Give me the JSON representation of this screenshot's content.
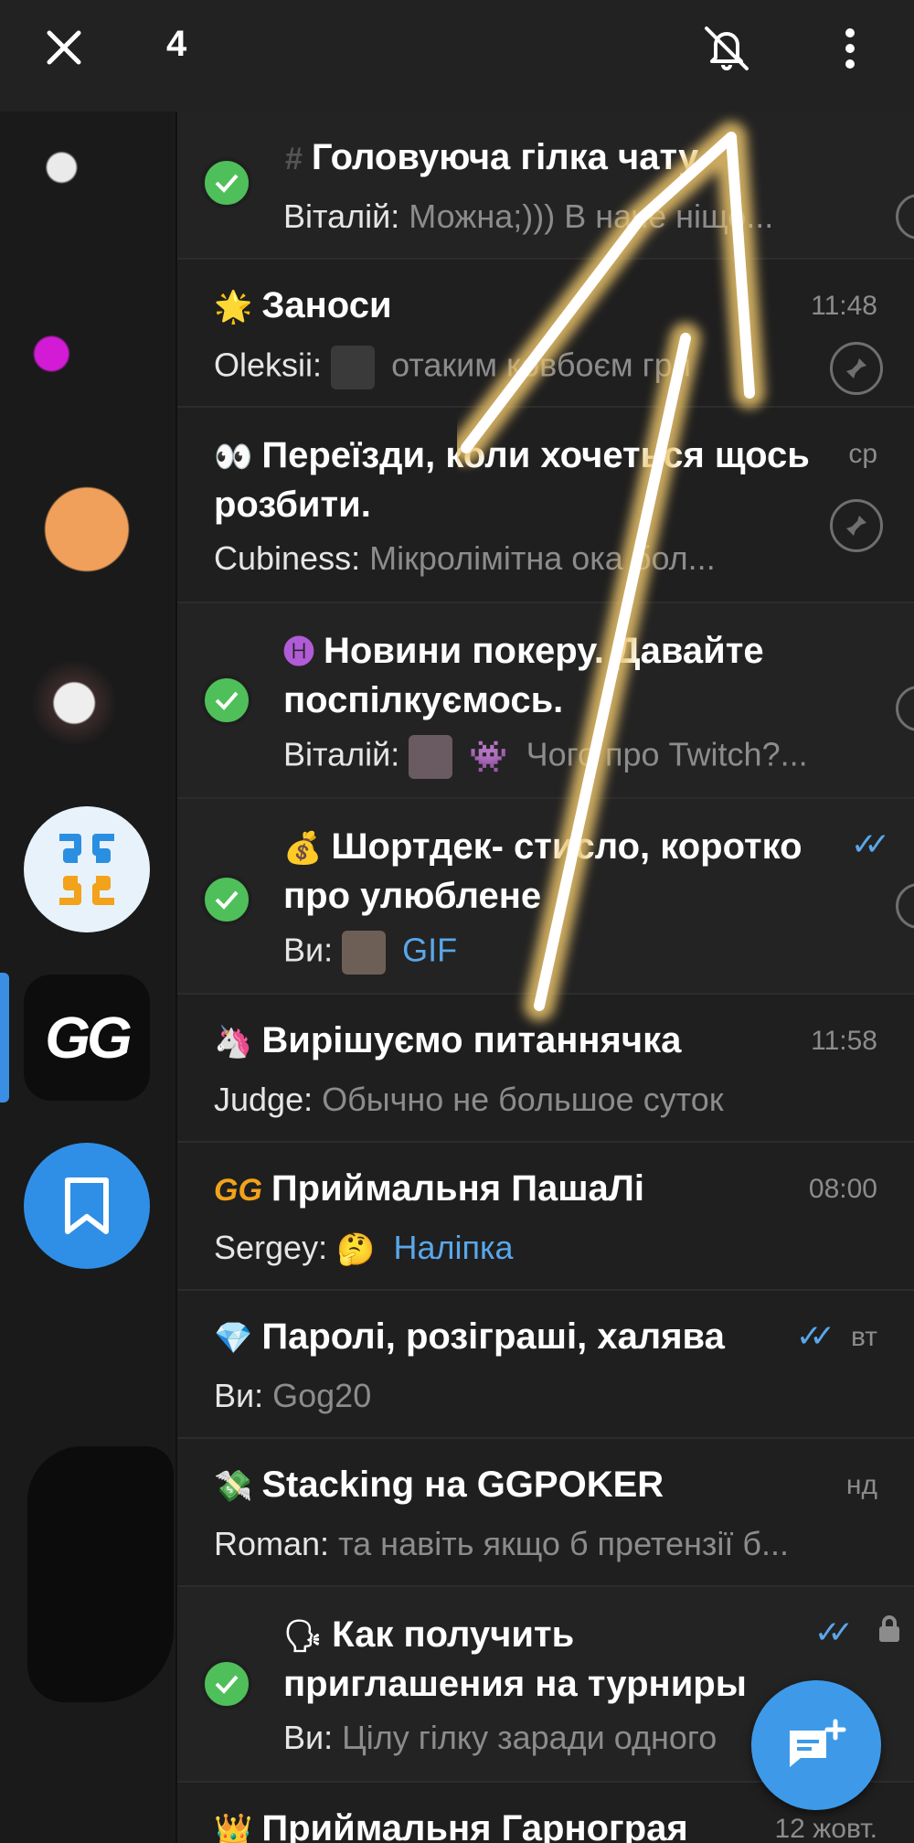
{
  "topbar": {
    "selected_count": "4",
    "close_icon": "close-icon",
    "mute_icon": "mute-icon",
    "menu_icon": "more-vert-icon"
  },
  "sidebar": {
    "folders": [
      "avatar-1",
      "avatar-2",
      "avatar-3",
      "avatar-4",
      "poker-club-logo",
      "ggpoker-logo",
      "saved-messages"
    ],
    "gg_label": "GG"
  },
  "chats": [
    {
      "title": "Головуюча гілка чату",
      "sender": "Віталій:",
      "preview": "Можна;))) В наче ніщо...",
      "selected": true
    },
    {
      "title": "Заноси",
      "sender": "Oleksii:",
      "preview": "отаким ковбоєм гри",
      "time": "11:48",
      "pinned": true
    },
    {
      "title": "Переїзди, коли хочеться щось розбити.",
      "sender": "Cubiness:",
      "preview": "Мікролімітна ока бол...",
      "time": "ср",
      "pinned": true
    },
    {
      "title": "Новини покеру. Давайте поспілкуємось.",
      "sender": "Віталій:",
      "preview": "Чого про Twitch?...",
      "selected": true
    },
    {
      "title": "Шортдек- стисло, коротко про улюблене",
      "sender": "Ви:",
      "preview": "GIF",
      "selected": true
    },
    {
      "title": "Вирішуємо питаннячка",
      "sender": "Judge:",
      "preview": "Обычно не большое суток",
      "time": "11:58"
    },
    {
      "title": "Приймальня ПашаЛі",
      "sender": "Sergey:",
      "preview": "Наліпка",
      "time": "08:00"
    },
    {
      "title": "Паролі, розіграші, халява",
      "sender": "Ви:",
      "preview": "Gog20",
      "time": "вт"
    },
    {
      "title": "Stacking на GGPOKER",
      "sender": "Roman:",
      "preview": "та навіть якщо б претензії б...",
      "time": "нд"
    },
    {
      "title": "Как получить приглашения на турниры",
      "sender": "Ви:",
      "preview": "Цілу гілку заради одного",
      "selected": true
    },
    {
      "title": "Приймальня Гарнограя",
      "time": "12 жовт."
    }
  ],
  "emojis": {
    "star": "🌟",
    "eyes": "👀",
    "h": "🅗",
    "bag": "💰",
    "unicorn": "🦄",
    "gg": "GG",
    "diamond": "💎",
    "money": "💸",
    "speak": "🗣",
    "crown": "👑",
    "hash": "#",
    "thinking": "🤔",
    "invader": "👾"
  },
  "colors": {
    "accent": "#3e9ae8",
    "check": "#4fbf5a",
    "background": "#1f1f1f"
  }
}
